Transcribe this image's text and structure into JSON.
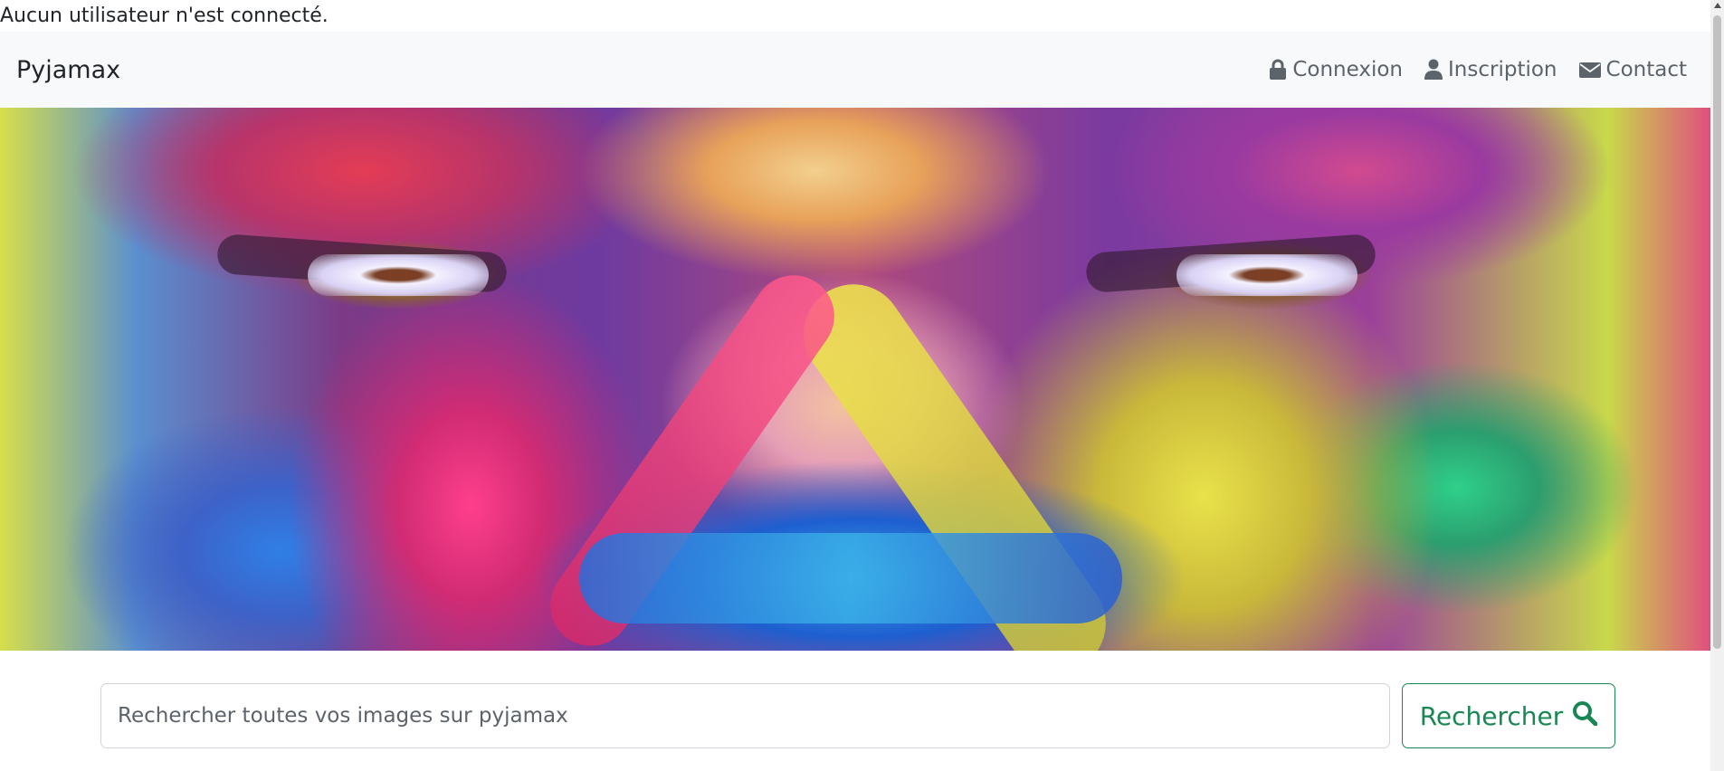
{
  "status": {
    "text": "Aucun utilisateur n'est connecté."
  },
  "navbar": {
    "brand": "Pyjamax",
    "links": [
      {
        "label": "Connexion",
        "icon": "lock-icon"
      },
      {
        "label": "Inscription",
        "icon": "user-icon"
      },
      {
        "label": "Contact",
        "icon": "envelope-icon"
      }
    ],
    "background": "#f8f9fa"
  },
  "hero": {
    "image": "colorful-painted-face"
  },
  "search": {
    "placeholder": "Rechercher toutes vos images sur pyjamax",
    "value": "",
    "button_label": "Rechercher",
    "button_icon": "search-icon",
    "accent_color": "#198754"
  }
}
